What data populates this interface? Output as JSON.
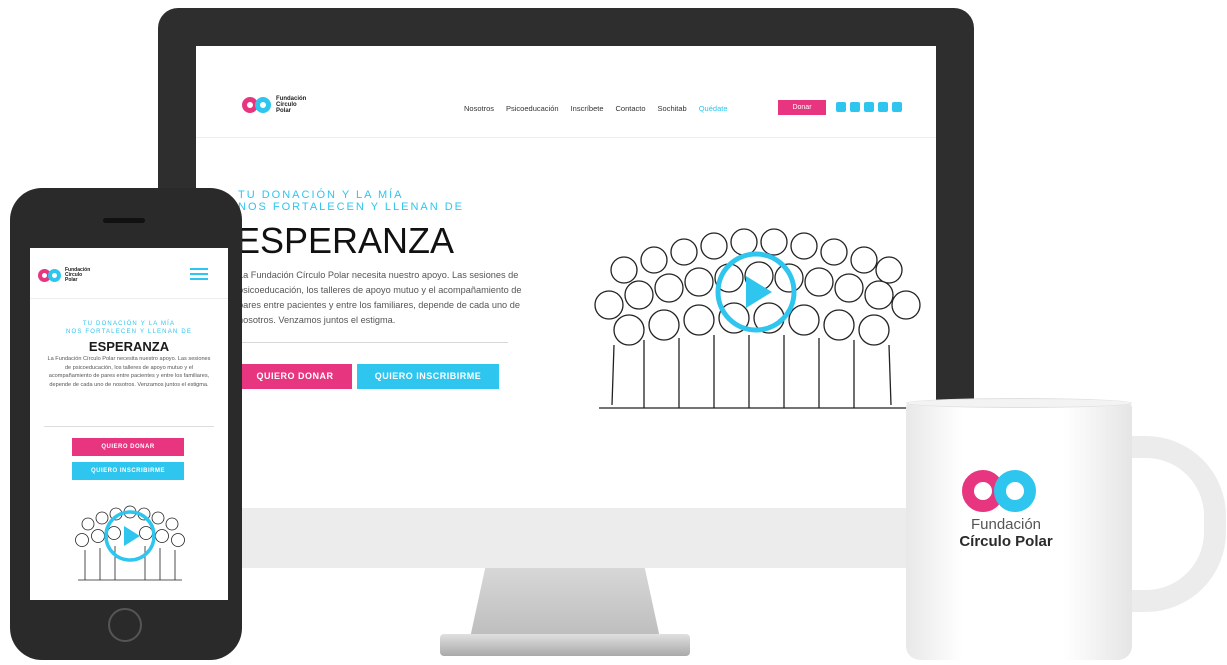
{
  "brand": {
    "name_lines": [
      "Fundación",
      "Círculo",
      "Polar"
    ],
    "mug_line1": "Fundación",
    "mug_line2": "Círculo Polar",
    "colors": {
      "pink": "#e8357f",
      "cyan": "#2ec5ef",
      "dark": "#2e2e2e"
    }
  },
  "desktop": {
    "nav": [
      "Nosotros",
      "Psicoeducación",
      "Inscríbete",
      "Contacto",
      "Sochitab",
      "Quédate"
    ],
    "nav_active": "Quédate",
    "donate_label": "Donar",
    "social_icons": [
      "instagram-icon",
      "facebook-icon",
      "linkedin-icon",
      "youtube-icon",
      "twitter-icon"
    ],
    "kicker_line1": "TU DONACIÓN Y LA MÍA",
    "kicker_line2": "NOS FORTALECEN Y LLENAN DE",
    "title": "ESPERANZA",
    "desc": "La Fundación Círculo Polar necesita nuestro apoyo. Las sesiones de psicoeducación, los talleres de apoyo mutuo y el acompañamiento de pares entre pacientes y entre los familiares, depende de cada uno de nosotros. Venzamos juntos el estigma.",
    "btn_donate": "QUIERO DONAR",
    "btn_register": "QUIERO INSCRIBIRME"
  },
  "mobile": {
    "kicker_line1": "TU DONACIÓN Y LA MÍA",
    "kicker_line2": "NOS FORTALECEN Y LLENAN DE",
    "title": "ESPERANZA",
    "desc": "La Fundación Círculo Polar necesita nuestro apoyo. Las sesiones de psicoeducación, los talleres de apoyo mutuo y el acompañamiento de pares entre pacientes y entre los familiares, depende de cada uno de nosotros. Venzamos juntos el estigma.",
    "btn_donate": "QUIERO DONAR",
    "btn_register": "QUIERO INSCRIBIRME"
  }
}
